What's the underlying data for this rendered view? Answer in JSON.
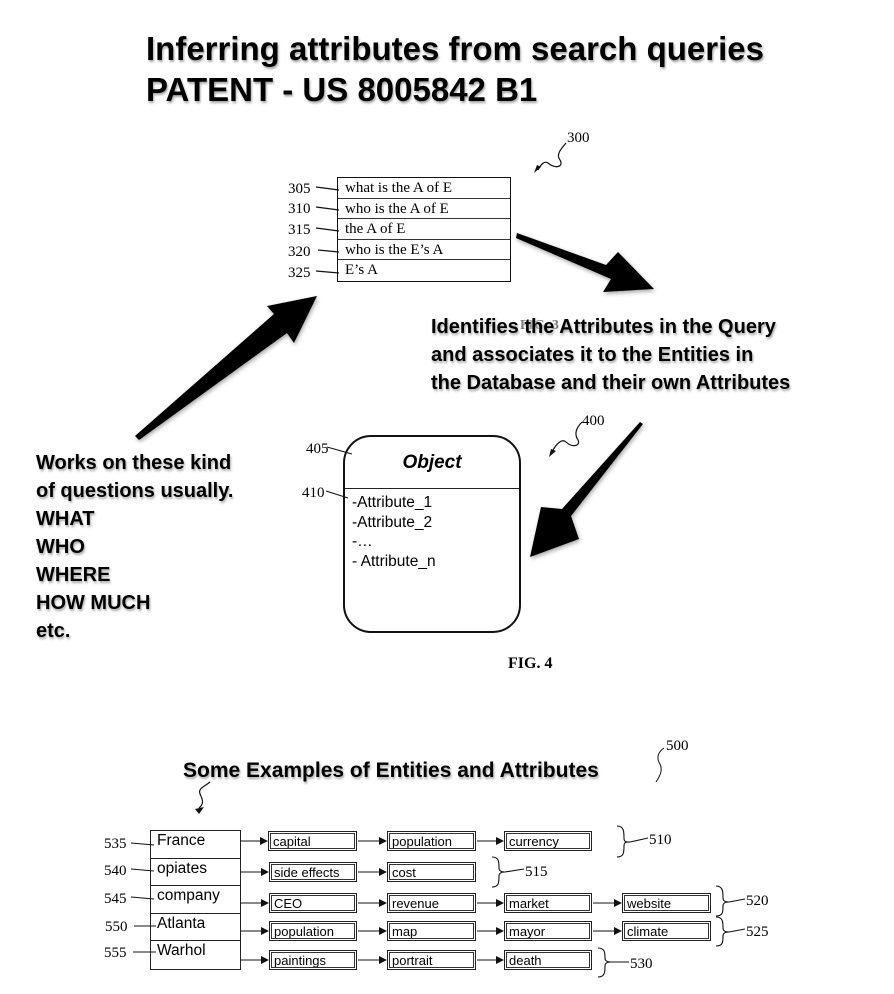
{
  "title": {
    "line1": "Inferring attributes from search queries",
    "line2": "PATENT - US 8005842 B1"
  },
  "fig3": {
    "ref": "300",
    "rows": [
      {
        "ref": "305",
        "text": "what is the A of E"
      },
      {
        "ref": "310",
        "text": "who is the A of E"
      },
      {
        "ref": "315",
        "text": "the A of E"
      },
      {
        "ref": "320",
        "text": "who is the E’s A"
      },
      {
        "ref": "325",
        "text": "E’s A"
      }
    ]
  },
  "annotations": {
    "identifies": [
      "Identifies the Attributes in the Query",
      "and associates it to the Entities in",
      "the Database and their own Attributes"
    ],
    "works_on": [
      "Works on these kind",
      "of questions usually.",
      "WHAT",
      "WHO",
      "WHERE",
      "HOW MUCH",
      "etc."
    ]
  },
  "fig4": {
    "ref": "400",
    "object_ref": "405",
    "attrs_ref": "410",
    "object_title": "Object",
    "attributes": [
      "-Attribute_1",
      "-Attribute_2",
      "-…",
      "- Attribute_n"
    ],
    "caption": "FIG. 4"
  },
  "fig5": {
    "ref": "500",
    "heading": "Some Examples of Entities and Attributes",
    "rows": [
      {
        "ref": "535",
        "entity": "France",
        "attributes": [
          "capital",
          "population",
          "currency"
        ],
        "group_ref": "510"
      },
      {
        "ref": "540",
        "entity": "opiates",
        "attributes": [
          "side effects",
          "cost"
        ],
        "group_ref": "515"
      },
      {
        "ref": "545",
        "entity": "company",
        "attributes": [
          "CEO",
          "revenue",
          "market",
          "website"
        ],
        "group_ref": "520"
      },
      {
        "ref": "550",
        "entity": "Atlanta",
        "attributes": [
          "population",
          "map",
          "mayor",
          "climate"
        ],
        "group_ref": "525"
      },
      {
        "ref": "555",
        "entity": "Warhol",
        "attributes": [
          "paintings",
          "portrait",
          "death"
        ],
        "group_ref": "530"
      }
    ]
  }
}
